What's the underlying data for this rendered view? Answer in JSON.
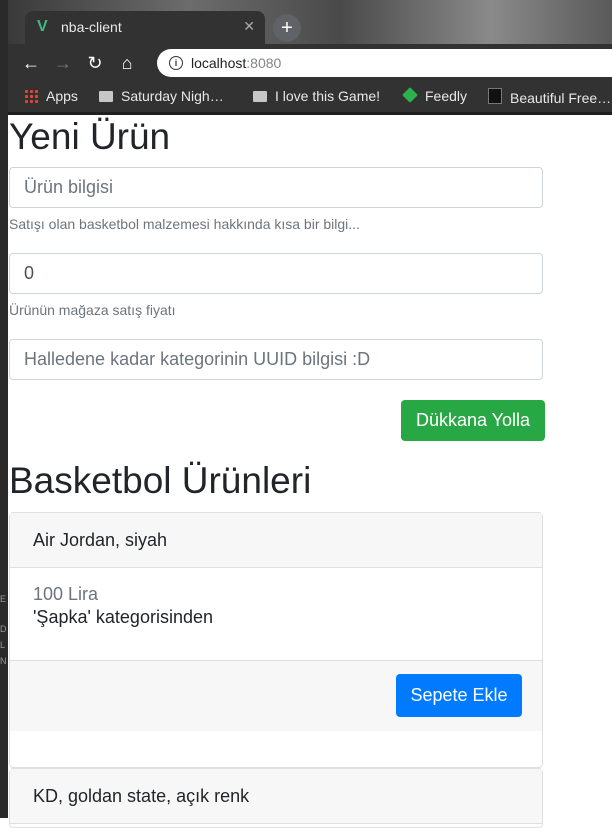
{
  "browser": {
    "tab": {
      "title": "nba-client",
      "favicon": "vue-logo-icon"
    },
    "url": {
      "host": "localhost",
      "port": ":8080"
    },
    "bookmarks": [
      "Apps",
      "Saturday Nigh…",
      "I love this Game!",
      "Feedly",
      "Beautiful Free…"
    ]
  },
  "desktop_fragments": [
    "E",
    "D",
    "L",
    "N"
  ],
  "form": {
    "title": "Yeni Ürün",
    "info_placeholder": "Ürün bilgisi",
    "info_help": "Satışı olan basketbol malzemesi hakkında kısa bir bilgi...",
    "price_value": "0",
    "price_help": "Ürünün mağaza satış fiyatı",
    "category_placeholder": "Halledene kadar kategorinin UUID bilgisi :D",
    "submit_label": "Dükkana Yolla"
  },
  "products": {
    "title": "Basketbol Ürünleri",
    "items": [
      {
        "name": "Air Jordan, siyah",
        "price": "100 Lira",
        "category": "'Şapka' kategorisinden",
        "button": "Sepete Ekle"
      },
      {
        "name": "KD, goldan state, açık renk"
      }
    ]
  },
  "colors": {
    "submit": "#28a745",
    "add_to_cart": "#007bff",
    "text": "#212529",
    "muted": "#6c757d"
  }
}
